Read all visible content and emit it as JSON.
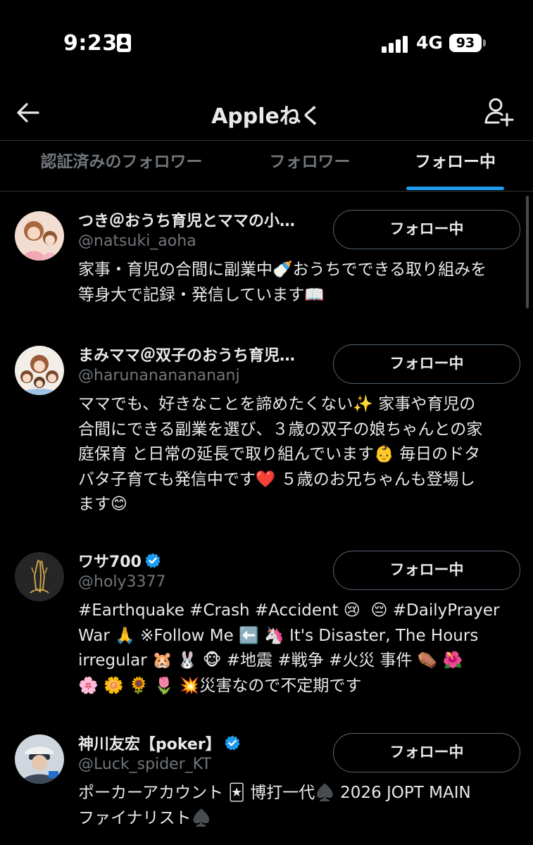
{
  "status_bar": {
    "time": "9:23",
    "network": "4G",
    "battery": "93"
  },
  "nav": {
    "title": "Appleねく",
    "back_icon": "arrow-left-icon",
    "add_user_icon": "person-plus-icon"
  },
  "tabs": [
    {
      "label": "認証済みのフォロワー",
      "active": false
    },
    {
      "label": "フォロワー",
      "active": false
    },
    {
      "label": "フォロー中",
      "active": true
    }
  ],
  "accent_color": "#1d9bf0",
  "users": [
    {
      "name": "つき＠おうち育児とママの小…",
      "handle": "@natsuki_aoha",
      "verified": false,
      "button": "フォロー中",
      "bio": "家事・育児の合間に副業中🍼おうちでできる取り組みを\n等身大で記録・発信しています📖"
    },
    {
      "name": "まみママ＠双子のおうち育児…",
      "handle": "@harunanananananj",
      "verified": false,
      "button": "フォロー中",
      "bio": "ママでも、好きなことを諦めたくない✨ 家事や育児の\n合間にできる副業を選び、３歳の双子の娘ちゃんとの家\n庭保育 と日常の延長で取り組んでいます👶 毎日のドタ\nバタ子育ても発信中です❤️ ５歳のお兄ちゃんも登場し\nます😊"
    },
    {
      "name": "ワサ700",
      "handle": "@holy3377",
      "verified": true,
      "button": "フォロー中",
      "bio": "#Earthquake #Crash #Accident 😢  😔 #DailyPrayer\nWar 🙏 ※Follow Me ⬅️ 🦄 It's Disaster, The Hours\nirregular 🐹 🐰 🐵 #地震 #戦争 #火災 事件 ⚰️ 🌺\n🌸 🌼 🌻 🌷 💥災害なので不定期です"
    },
    {
      "name": "神川友宏【poker】",
      "handle": "@Luck_spider_KT",
      "verified": true,
      "button": "フォロー中",
      "bio": "ポーカーアカウント 🃏 博打一代♠️ 2026 JOPT MAIN\nファイナリスト♠️"
    }
  ]
}
